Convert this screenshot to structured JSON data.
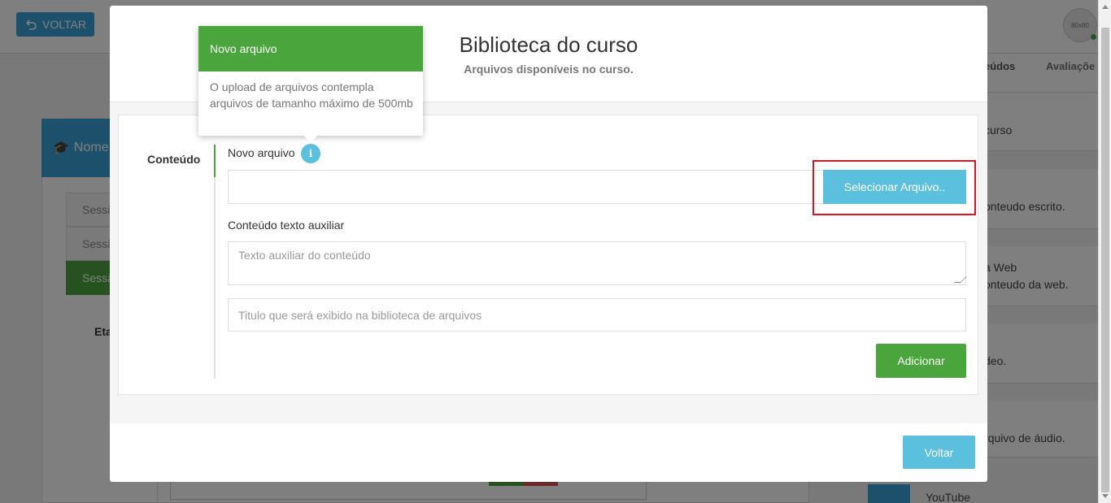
{
  "background": {
    "back_button_label": "VOLTAR",
    "avatar_text": "80x80",
    "nome_label": "Nome",
    "sessions": [
      "Sessã",
      "Sessã",
      "Sessã"
    ],
    "eta_label": "Eta",
    "tabs": [
      "eúdos",
      "Avaliaçõe"
    ],
    "right_items": [
      "curso",
      "onteudo escrito.",
      "a Web",
      "onteudo da web.",
      "deo.",
      "rquivo de áudio."
    ],
    "youtube_label": "YouTube"
  },
  "modal": {
    "title": "Biblioteca do curso",
    "subtitle": "Arquivos disponíveis no curso.",
    "side_label": "Conteúdo",
    "file_label": "Novo arquivo",
    "select_button": "Selecionar Arquivo..",
    "aux_label": "Conteúdo texto auxiliar",
    "aux_placeholder": "Texto auxiliar do conteúdo",
    "title_placeholder": "Titulo que será exibido na biblioteca de arquivos",
    "add_button": "Adicionar",
    "back_button": "Voltar"
  },
  "popover": {
    "title": "Novo arquivo",
    "content": "O upload de arquivos contempla arquivos de tamanho máximo de 500mb"
  },
  "colors": {
    "green": "#4aa53c",
    "info_blue": "#5bc0de",
    "highlight_red": "#e5121b"
  }
}
